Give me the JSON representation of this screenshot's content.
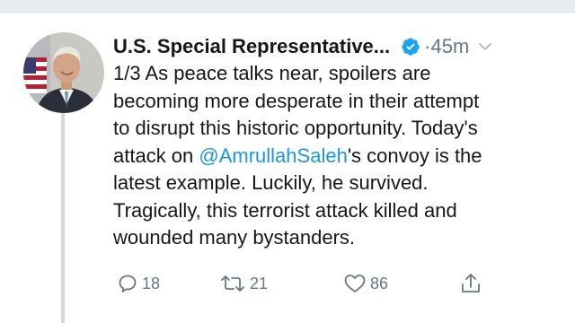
{
  "tweet": {
    "author": {
      "display_name": "U.S. Special Representative...",
      "verified": true
    },
    "timestamp": "45m",
    "separator": "·",
    "lines": [
      "1/3 As peace talks near, spoilers are",
      "becoming more desperate in their attempt",
      "to disrupt this historic opportunity. Today's",
      "attack on ",
      "latest example. Luckily, he survived.",
      "Tragically, this terrorist attack killed and",
      "wounded many bystanders."
    ],
    "mention": "@AmrullahSaleh",
    "after_mention": "'s convoy is the",
    "actions": {
      "replies": "18",
      "retweets": "21",
      "likes": "86"
    }
  },
  "icons": {
    "verified": "verified-badge-icon",
    "caret": "chevron-down-icon",
    "reply": "reply-icon",
    "retweet": "retweet-icon",
    "like": "heart-icon",
    "share": "share-icon"
  },
  "colors": {
    "text": "#14171a",
    "secondary": "#657786",
    "link": "#1b95e0",
    "verified": "#1da1f2"
  }
}
